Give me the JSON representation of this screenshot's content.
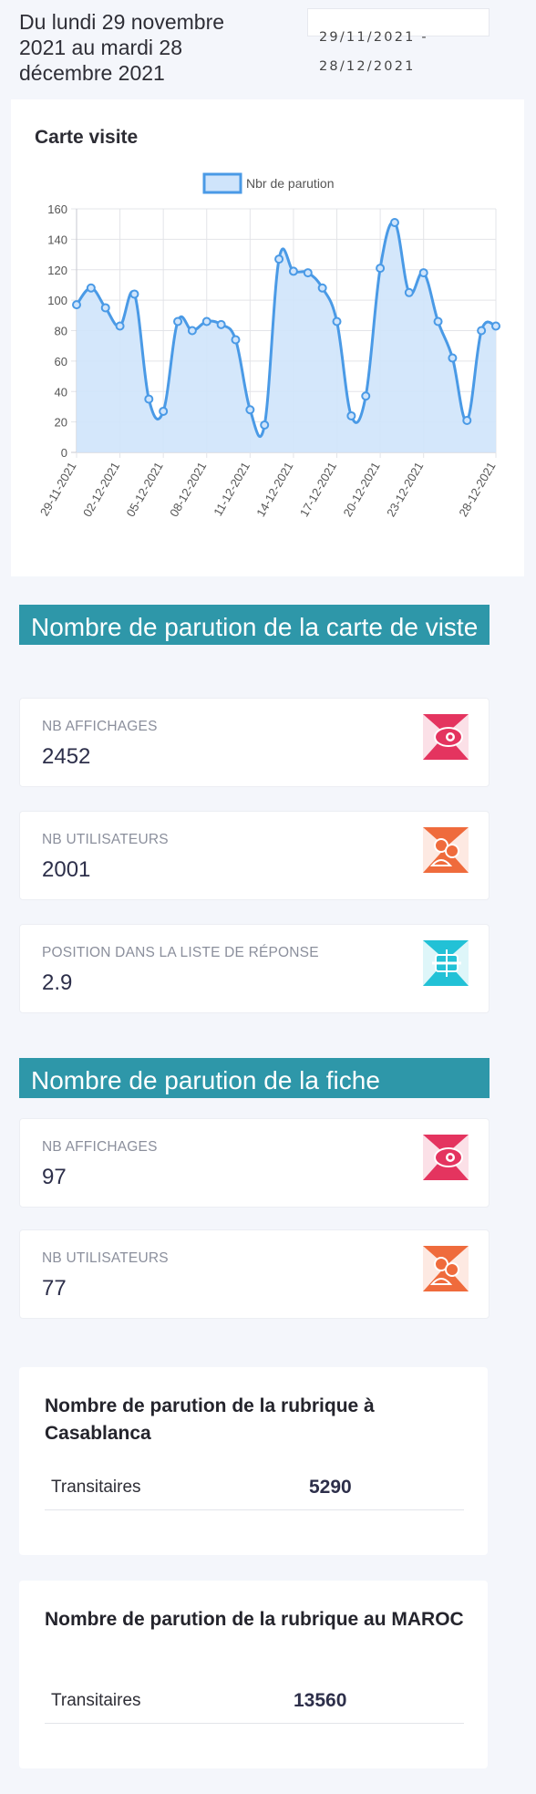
{
  "header": {
    "period_title": "Du lundi 29 novembre 2021 au mardi 28 décembre 2021",
    "date_range_value": "29/11/2021 - 28/12/2021"
  },
  "chart_card": {
    "title": "Carte visite"
  },
  "chart_data": {
    "type": "area",
    "title": "Carte visite",
    "legend": {
      "position": "top",
      "entries": [
        "Nbr de parution"
      ]
    },
    "series": [
      {
        "name": "Nbr de parution",
        "color": "#4a9ae6",
        "fill": "#cfe4fb",
        "values": [
          97,
          108,
          95,
          83,
          104,
          35,
          27,
          86,
          80,
          86,
          84,
          74,
          28,
          18,
          127,
          119,
          118,
          108,
          86,
          24,
          37,
          121,
          151,
          105,
          118,
          86,
          62,
          21,
          80,
          83
        ]
      }
    ],
    "x": [
      "29-11-2021",
      "30-11-2021",
      "01-12-2021",
      "02-12-2021",
      "03-12-2021",
      "04-12-2021",
      "05-12-2021",
      "06-12-2021",
      "07-12-2021",
      "08-12-2021",
      "09-12-2021",
      "10-12-2021",
      "11-12-2021",
      "12-12-2021",
      "13-12-2021",
      "14-12-2021",
      "15-12-2021",
      "16-12-2021",
      "17-12-2021",
      "18-12-2021",
      "19-12-2021",
      "20-12-2021",
      "21-12-2021",
      "22-12-2021",
      "23-12-2021",
      "24-12-2021",
      "25-12-2021",
      "26-12-2021",
      "27-12-2021",
      "28-12-2021"
    ],
    "x_tick_labels": [
      "29-11-2021",
      "02-12-2021",
      "05-12-2021",
      "08-12-2021",
      "11-12-2021",
      "14-12-2021",
      "17-12-2021",
      "20-12-2021",
      "23-12-2021",
      "28-12-2021"
    ],
    "ylim": [
      0,
      160
    ],
    "y_ticks": [
      0,
      20,
      40,
      60,
      80,
      100,
      120,
      140,
      160
    ],
    "grid": true
  },
  "section_carte": {
    "title": "Nombre de parution de la carte de viste",
    "stats": [
      {
        "label": "NB AFFICHAGES",
        "value": "2452",
        "icon": "eye-icon",
        "color": "#e4345f"
      },
      {
        "label": "NB UTILISATEURS",
        "value": "2001",
        "icon": "users-icon",
        "color": "#ef6b3c"
      },
      {
        "label": "POSITION DANS LA LISTE DE RÉPONSE",
        "value": "2.9",
        "icon": "list-position-icon",
        "color": "#22c1d6"
      }
    ]
  },
  "section_fiche": {
    "title": "Nombre de parution de la fiche",
    "stats": [
      {
        "label": "NB AFFICHAGES",
        "value": "97",
        "icon": "eye-icon",
        "color": "#e4345f"
      },
      {
        "label": "NB UTILISATEURS",
        "value": "77",
        "icon": "users-icon",
        "color": "#ef6b3c"
      }
    ]
  },
  "rubric_casablanca": {
    "title": "Nombre de parution de la rubrique à Casablanca",
    "rows": [
      {
        "name": "Transitaires",
        "value": "5290"
      }
    ]
  },
  "rubric_maroc": {
    "title": "Nombre de parution de la rubrique au MAROC",
    "rows": [
      {
        "name": "Transitaires",
        "value": "13560"
      }
    ]
  }
}
